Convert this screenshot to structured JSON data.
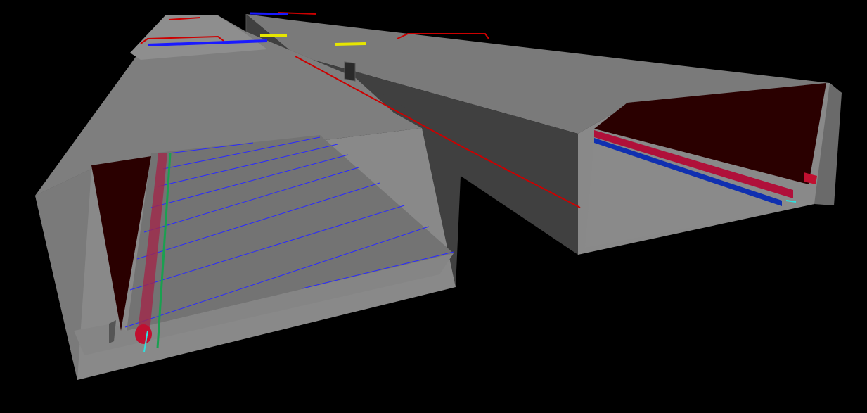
{
  "scene": {
    "background_color": "#000000",
    "colors": {
      "concrete_light": "#8a8a8a",
      "concrete_mid": "#7d7d7d",
      "concrete_dark": "#404040",
      "interior_red": "#2a0000",
      "pipe_red": "#b0103a",
      "pipe_blue": "#1030b0",
      "edge_red": "#cc0000",
      "marker_yellow": "#e6e600",
      "marker_blue": "#1a1aff",
      "cable_green": "#1aa050",
      "cable_cyan": "#30e0e0",
      "wire_blue": "#2a2aff"
    }
  }
}
